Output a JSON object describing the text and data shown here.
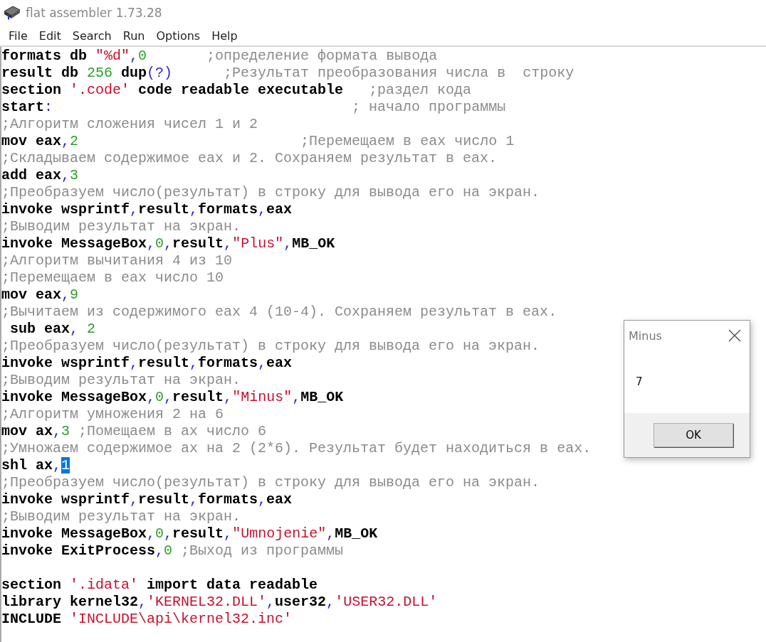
{
  "window": {
    "title": "flat assembler 1.73.28"
  },
  "menu": [
    "File",
    "Edit",
    "Search",
    "Run",
    "Options",
    "Help"
  ],
  "editor": {
    "lines": [
      {
        "kind": "code",
        "segments": [
          {
            "kind": "code",
            "text": "formats db "
          },
          {
            "kind": "string",
            "text": "\"%d\""
          },
          {
            "kind": "symbol",
            "text": ","
          },
          {
            "kind": "number",
            "text": "0"
          },
          {
            "kind": "comment",
            "text": "       ;определение формата вывода"
          }
        ]
      },
      {
        "kind": "code",
        "segments": [
          {
            "kind": "code",
            "text": "result db "
          },
          {
            "kind": "number",
            "text": "256"
          },
          {
            "kind": "code",
            "text": " dup"
          },
          {
            "kind": "symbol",
            "text": "(?)"
          },
          {
            "kind": "comment",
            "text": "      ;Результат преобразования числа в  строку"
          }
        ]
      },
      {
        "kind": "code",
        "segments": [
          {
            "kind": "code",
            "text": "section "
          },
          {
            "kind": "string",
            "text": "'.code'"
          },
          {
            "kind": "code",
            "text": " code readable executable"
          },
          {
            "kind": "comment",
            "text": "   ;раздел кода"
          }
        ]
      },
      {
        "kind": "code",
        "segments": [
          {
            "kind": "code",
            "text": "start"
          },
          {
            "kind": "symbol",
            "text": ":"
          },
          {
            "kind": "comment",
            "text": "                                   ; начало программы"
          }
        ]
      },
      {
        "kind": "code",
        "segments": [
          {
            "kind": "comment",
            "text": ";Алгоритм сложения чисел 1 и 2"
          }
        ]
      },
      {
        "kind": "code",
        "segments": [
          {
            "kind": "code",
            "text": "mov eax"
          },
          {
            "kind": "symbol",
            "text": ","
          },
          {
            "kind": "number",
            "text": "2"
          },
          {
            "kind": "comment",
            "text": "                          ;Перемещаем в eax число 1"
          }
        ]
      },
      {
        "kind": "code",
        "segments": [
          {
            "kind": "comment",
            "text": ";Складываем содержимое eax и 2. Сохраняем результат в eax."
          }
        ]
      },
      {
        "kind": "code",
        "segments": [
          {
            "kind": "code",
            "text": "add eax"
          },
          {
            "kind": "symbol",
            "text": ","
          },
          {
            "kind": "number",
            "text": "3"
          }
        ]
      },
      {
        "kind": "code",
        "segments": [
          {
            "kind": "comment",
            "text": ";Преобразуем число(результат) в строку для вывода его на экран."
          }
        ]
      },
      {
        "kind": "code",
        "segments": [
          {
            "kind": "code",
            "text": "invoke wsprintf"
          },
          {
            "kind": "symbol",
            "text": ","
          },
          {
            "kind": "code",
            "text": "result"
          },
          {
            "kind": "symbol",
            "text": ","
          },
          {
            "kind": "code",
            "text": "formats"
          },
          {
            "kind": "symbol",
            "text": ","
          },
          {
            "kind": "code",
            "text": "eax"
          }
        ]
      },
      {
        "kind": "code",
        "segments": [
          {
            "kind": "comment",
            "text": ";Выводим результат на экран."
          }
        ]
      },
      {
        "kind": "code",
        "segments": [
          {
            "kind": "code",
            "text": "invoke MessageBox"
          },
          {
            "kind": "symbol",
            "text": ","
          },
          {
            "kind": "number",
            "text": "0"
          },
          {
            "kind": "symbol",
            "text": ","
          },
          {
            "kind": "code",
            "text": "result"
          },
          {
            "kind": "symbol",
            "text": ","
          },
          {
            "kind": "string",
            "text": "\"Plus\""
          },
          {
            "kind": "symbol",
            "text": ","
          },
          {
            "kind": "code",
            "text": "MB_OK"
          }
        ]
      },
      {
        "kind": "code",
        "segments": [
          {
            "kind": "comment",
            "text": ";Алгоритм вычитания 4 из 10"
          }
        ]
      },
      {
        "kind": "code",
        "segments": [
          {
            "kind": "comment",
            "text": ";Перемещаем в eax число 10"
          }
        ]
      },
      {
        "kind": "code",
        "segments": [
          {
            "kind": "code",
            "text": "mov eax"
          },
          {
            "kind": "symbol",
            "text": ","
          },
          {
            "kind": "number",
            "text": "9"
          }
        ]
      },
      {
        "kind": "code",
        "segments": [
          {
            "kind": "comment",
            "text": ";Вычитаем из содержимого eax 4 (10-4). Сохраняем результат в eax."
          }
        ]
      },
      {
        "kind": "code",
        "segments": [
          {
            "kind": "code",
            "text": " sub eax"
          },
          {
            "kind": "symbol",
            "text": ", "
          },
          {
            "kind": "number",
            "text": "2"
          }
        ]
      },
      {
        "kind": "code",
        "segments": [
          {
            "kind": "comment",
            "text": ";Преобразуем число(результат) в строку для вывода его на экран."
          }
        ]
      },
      {
        "kind": "code",
        "segments": [
          {
            "kind": "code",
            "text": "invoke wsprintf"
          },
          {
            "kind": "symbol",
            "text": ","
          },
          {
            "kind": "code",
            "text": "result"
          },
          {
            "kind": "symbol",
            "text": ","
          },
          {
            "kind": "code",
            "text": "formats"
          },
          {
            "kind": "symbol",
            "text": ","
          },
          {
            "kind": "code",
            "text": "eax"
          }
        ]
      },
      {
        "kind": "code",
        "segments": [
          {
            "kind": "comment",
            "text": ";Выводим результат на экран."
          }
        ]
      },
      {
        "kind": "code",
        "segments": [
          {
            "kind": "code",
            "text": "invoke MessageBox"
          },
          {
            "kind": "symbol",
            "text": ","
          },
          {
            "kind": "number",
            "text": "0"
          },
          {
            "kind": "symbol",
            "text": ","
          },
          {
            "kind": "code",
            "text": "result"
          },
          {
            "kind": "symbol",
            "text": ","
          },
          {
            "kind": "string",
            "text": "\"Minus\""
          },
          {
            "kind": "symbol",
            "text": ","
          },
          {
            "kind": "code",
            "text": "MB_OK"
          }
        ]
      },
      {
        "kind": "code",
        "segments": [
          {
            "kind": "comment",
            "text": ";Алгоритм умножения 2 на 6"
          }
        ]
      },
      {
        "kind": "code",
        "segments": [
          {
            "kind": "code",
            "text": "mov ax"
          },
          {
            "kind": "symbol",
            "text": ","
          },
          {
            "kind": "number",
            "text": "3"
          },
          {
            "kind": "comment",
            "text": " ;Помещаем в ax число 6"
          }
        ]
      },
      {
        "kind": "code",
        "segments": [
          {
            "kind": "comment",
            "text": ";Умножаем содержимое ax на 2 (2*6). Результат будет находиться в eax."
          }
        ]
      },
      {
        "kind": "code",
        "segments": [
          {
            "kind": "code",
            "text": "shl ax"
          },
          {
            "kind": "symbol",
            "text": ","
          },
          {
            "kind": "selection",
            "text": "1"
          }
        ]
      },
      {
        "kind": "code",
        "segments": [
          {
            "kind": "comment",
            "text": ";Преобразуем число(результат) в строку для вывода его на экран."
          }
        ]
      },
      {
        "kind": "code",
        "segments": [
          {
            "kind": "code",
            "text": "invoke wsprintf"
          },
          {
            "kind": "symbol",
            "text": ","
          },
          {
            "kind": "code",
            "text": "result"
          },
          {
            "kind": "symbol",
            "text": ","
          },
          {
            "kind": "code",
            "text": "formats"
          },
          {
            "kind": "symbol",
            "text": ","
          },
          {
            "kind": "code",
            "text": "eax"
          }
        ]
      },
      {
        "kind": "code",
        "segments": [
          {
            "kind": "comment",
            "text": ";Выводим результат на экран."
          }
        ]
      },
      {
        "kind": "code",
        "segments": [
          {
            "kind": "code",
            "text": "invoke MessageBox"
          },
          {
            "kind": "symbol",
            "text": ","
          },
          {
            "kind": "number",
            "text": "0"
          },
          {
            "kind": "symbol",
            "text": ","
          },
          {
            "kind": "code",
            "text": "result"
          },
          {
            "kind": "symbol",
            "text": ","
          },
          {
            "kind": "string",
            "text": "\"Umnojenie\""
          },
          {
            "kind": "symbol",
            "text": ","
          },
          {
            "kind": "code",
            "text": "MB_OK"
          }
        ]
      },
      {
        "kind": "code",
        "segments": [
          {
            "kind": "code",
            "text": "invoke ExitProcess"
          },
          {
            "kind": "symbol",
            "text": ","
          },
          {
            "kind": "number",
            "text": "0"
          },
          {
            "kind": "comment",
            "text": " ;Выход из программы"
          }
        ]
      },
      {
        "kind": "blank"
      },
      {
        "kind": "code",
        "segments": [
          {
            "kind": "code",
            "text": "section "
          },
          {
            "kind": "string",
            "text": "'.idata'"
          },
          {
            "kind": "code",
            "text": " import data readable"
          }
        ]
      },
      {
        "kind": "code",
        "segments": [
          {
            "kind": "code",
            "text": "library kernel32"
          },
          {
            "kind": "symbol",
            "text": ","
          },
          {
            "kind": "string",
            "text": "'KERNEL32.DLL'"
          },
          {
            "kind": "symbol",
            "text": ","
          },
          {
            "kind": "code",
            "text": "user32"
          },
          {
            "kind": "symbol",
            "text": ","
          },
          {
            "kind": "string",
            "text": "'USER32.DLL'"
          }
        ]
      },
      {
        "kind": "code",
        "segments": [
          {
            "kind": "code",
            "text": "INCLUDE "
          },
          {
            "kind": "string",
            "text": "'INCLUDE\\api\\kernel32.inc'"
          }
        ]
      }
    ]
  },
  "dialog": {
    "title": "Minus",
    "message": "7",
    "buttons": [
      "OK"
    ]
  }
}
